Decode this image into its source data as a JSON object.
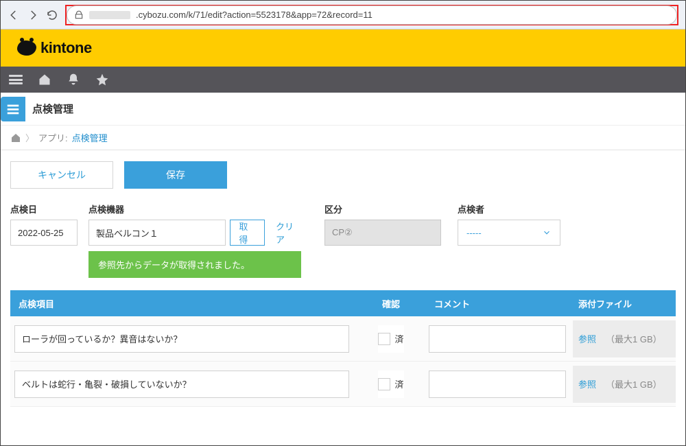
{
  "browser": {
    "url": ".cybozu.com/k/71/edit?action=5523178&app=72&record=11"
  },
  "brand": {
    "name": "kintone"
  },
  "page": {
    "title": "点検管理",
    "breadcrumb_app_label": "アプリ:",
    "breadcrumb_app_link": "点検管理"
  },
  "actions": {
    "cancel": "キャンセル",
    "save": "保存"
  },
  "form": {
    "labels": {
      "date": "点検日",
      "device": "点検機器",
      "category": "区分",
      "inspector": "点検者"
    },
    "date_value": "2022-05-25",
    "device_value": "製品ベルコン１",
    "lookup_get": "取得",
    "lookup_clear": "クリア",
    "category_value": "CP②",
    "inspector_value": "-----",
    "success_message": "参照先からデータが取得されました。"
  },
  "table": {
    "headers": {
      "item": "点検項目",
      "confirm": "確認",
      "comment": "コメント",
      "attachment": "添付ファイル"
    },
    "confirm_label": "済",
    "browse_label": "参照",
    "size_hint": "（最大1 GB）",
    "rows": [
      {
        "item": "ローラが回っているか？異音はないか？"
      },
      {
        "item": "ベルトは蛇行・亀裂・破損していないか？"
      }
    ]
  }
}
